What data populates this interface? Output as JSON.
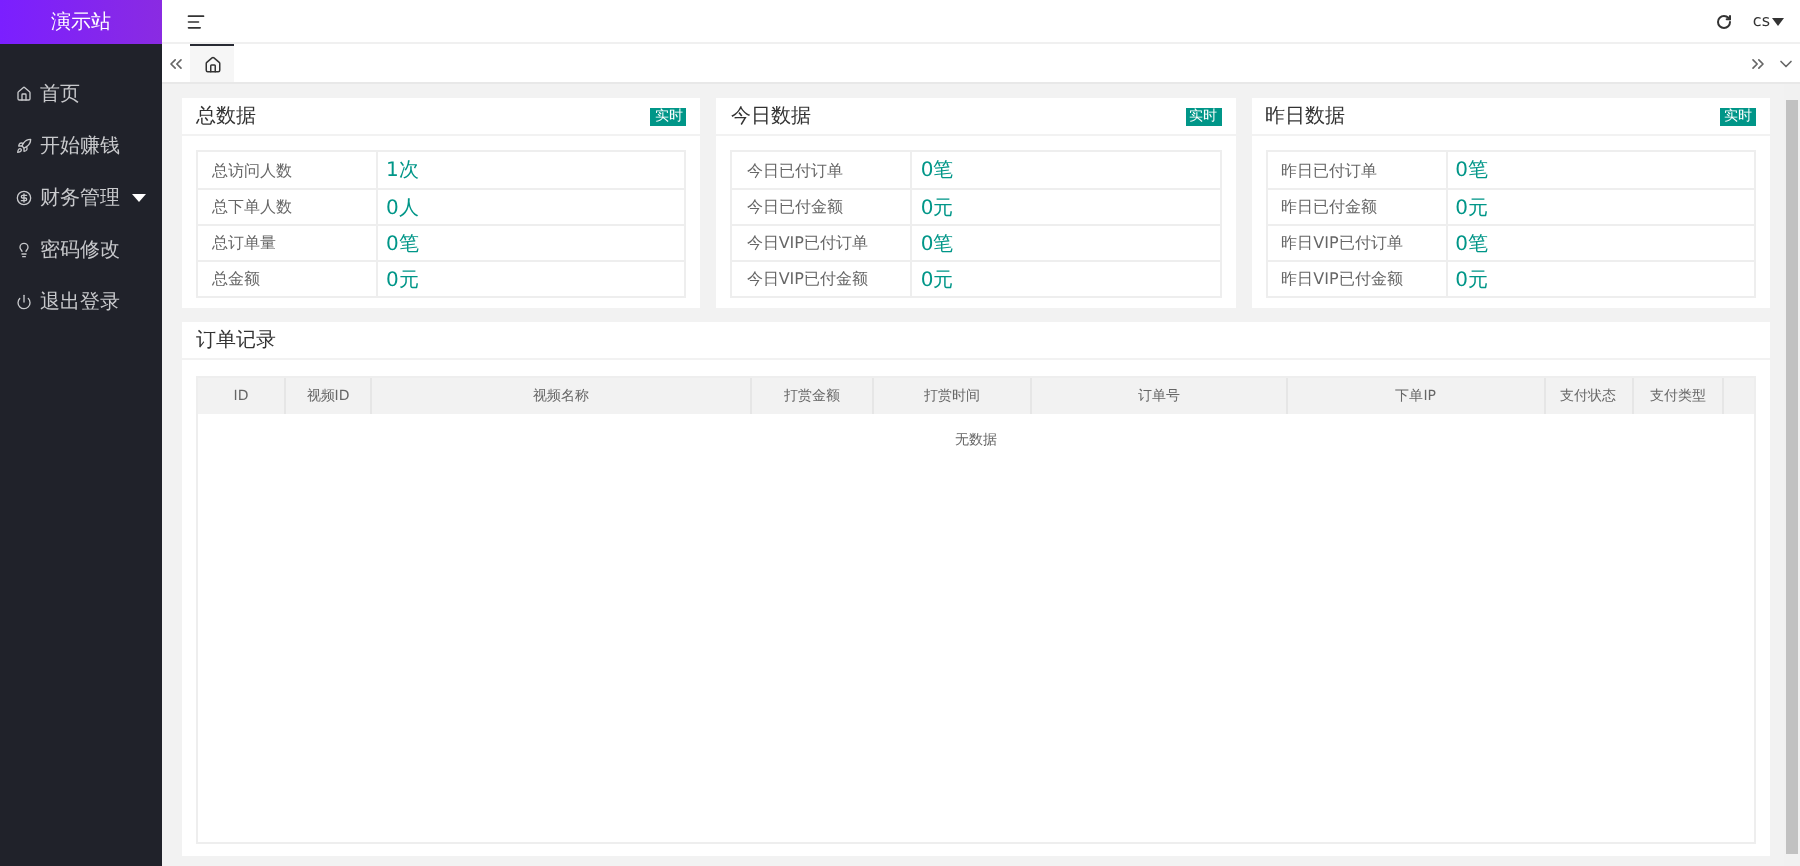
{
  "sidebar": {
    "logo": "演示站",
    "items": [
      {
        "label": "首页",
        "expandable": false,
        "selected": false
      },
      {
        "label": "开始赚钱",
        "expandable": false,
        "selected": false
      },
      {
        "label": "财务管理",
        "expandable": true,
        "selected": false
      },
      {
        "label": "密码修改",
        "expandable": false,
        "selected": false
      },
      {
        "label": "退出登录",
        "expandable": false,
        "selected": false
      }
    ]
  },
  "header": {
    "user": "cs"
  },
  "tabs": [
    {
      "selected": true
    }
  ],
  "cards": [
    {
      "title": "总数据",
      "badge": "实时",
      "rows": [
        {
          "label": "总访问人数",
          "value": "1次"
        },
        {
          "label": "总下单人数",
          "value": "0人"
        },
        {
          "label": "总订单量",
          "value": "0笔"
        },
        {
          "label": "总金额",
          "value": "0元"
        }
      ]
    },
    {
      "title": "今日数据",
      "badge": "实时",
      "rows": [
        {
          "label": "今日已付订单",
          "value": "0笔"
        },
        {
          "label": "今日已付金额",
          "value": "0元"
        },
        {
          "label": "今日VIP已付订单",
          "value": "0笔"
        },
        {
          "label": "今日VIP已付金额",
          "value": "0元"
        }
      ]
    },
    {
      "title": "昨日数据",
      "badge": "实时",
      "rows": [
        {
          "label": "昨日已付订单",
          "value": "0笔"
        },
        {
          "label": "昨日已付金额",
          "value": "0元"
        },
        {
          "label": "昨日VIP已付订单",
          "value": "0笔"
        },
        {
          "label": "昨日VIP已付金额",
          "value": "0元"
        }
      ]
    }
  ],
  "orders": {
    "title": "订单记录",
    "columns": [
      "ID",
      "视频ID",
      "视频名称",
      "打赏金额",
      "打赏时间",
      "订单号",
      "下单IP",
      "支付状态",
      "支付类型"
    ],
    "empty": "无数据"
  }
}
